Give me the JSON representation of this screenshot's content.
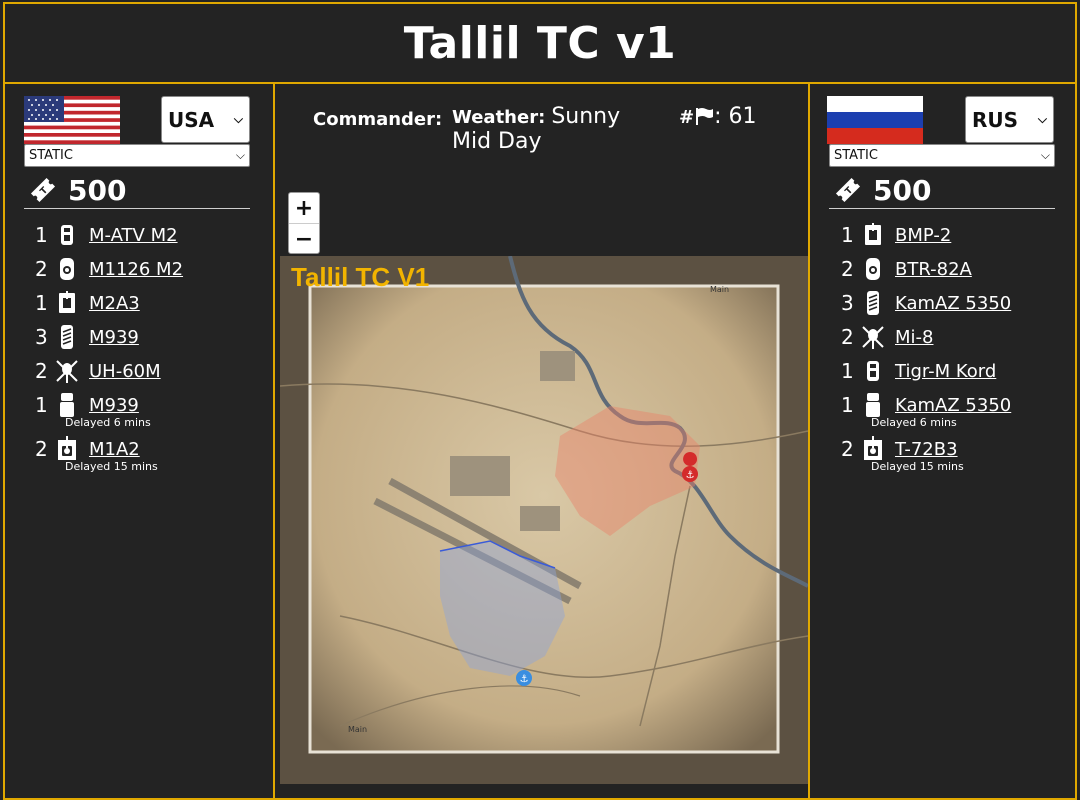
{
  "title": "Tallil TC v1",
  "left_team": {
    "faction": "USA",
    "mode": "STATIC",
    "tickets": "500",
    "units": [
      {
        "qty": "1",
        "name": "M-ATV M2",
        "icon": "mrap-icon",
        "delay": ""
      },
      {
        "qty": "2",
        "name": "M1126 M2",
        "icon": "apc-icon",
        "delay": ""
      },
      {
        "qty": "1",
        "name": "M2A3",
        "icon": "ifv-icon",
        "delay": ""
      },
      {
        "qty": "3",
        "name": "M939",
        "icon": "logistics-truck-icon",
        "delay": ""
      },
      {
        "qty": "2",
        "name": "UH-60M",
        "icon": "helicopter-icon",
        "delay": ""
      },
      {
        "qty": "1",
        "name": "M939",
        "icon": "transport-truck-icon",
        "delay": "Delayed 6 mins"
      },
      {
        "qty": "2",
        "name": "M1A2",
        "icon": "tank-icon",
        "delay": "Delayed 15 mins"
      }
    ]
  },
  "right_team": {
    "faction": "RUS",
    "mode": "STATIC",
    "tickets": "500",
    "units": [
      {
        "qty": "1",
        "name": "BMP-2",
        "icon": "ifv-icon",
        "delay": ""
      },
      {
        "qty": "2",
        "name": "BTR-82A",
        "icon": "apc-icon",
        "delay": ""
      },
      {
        "qty": "3",
        "name": "KamAZ 5350",
        "icon": "logistics-truck-icon",
        "delay": ""
      },
      {
        "qty": "2",
        "name": "Mi-8",
        "icon": "helicopter-icon",
        "delay": ""
      },
      {
        "qty": "1",
        "name": "Tigr-M Kord",
        "icon": "mrap-icon",
        "delay": ""
      },
      {
        "qty": "1",
        "name": "KamAZ 5350",
        "icon": "transport-truck-icon",
        "delay": "Delayed 6 mins"
      },
      {
        "qty": "2",
        "name": "T-72B3",
        "icon": "tank-icon",
        "delay": "Delayed 15 mins"
      }
    ]
  },
  "info": {
    "commander_label": "Commander:",
    "weather_label": "Weather:",
    "weather_value": "Sunny Mid Day",
    "flags_label": "#",
    "flags_value": ": 61"
  },
  "map": {
    "title": "Tallil TC V1",
    "zoom_in": "+",
    "zoom_out": "−",
    "main_marker_label": "Main"
  },
  "colors": {
    "accent": "#e0a800",
    "map_title": "#f2b400",
    "usa_zone": "#8fa3d9",
    "rus_zone": "#e8836a"
  }
}
